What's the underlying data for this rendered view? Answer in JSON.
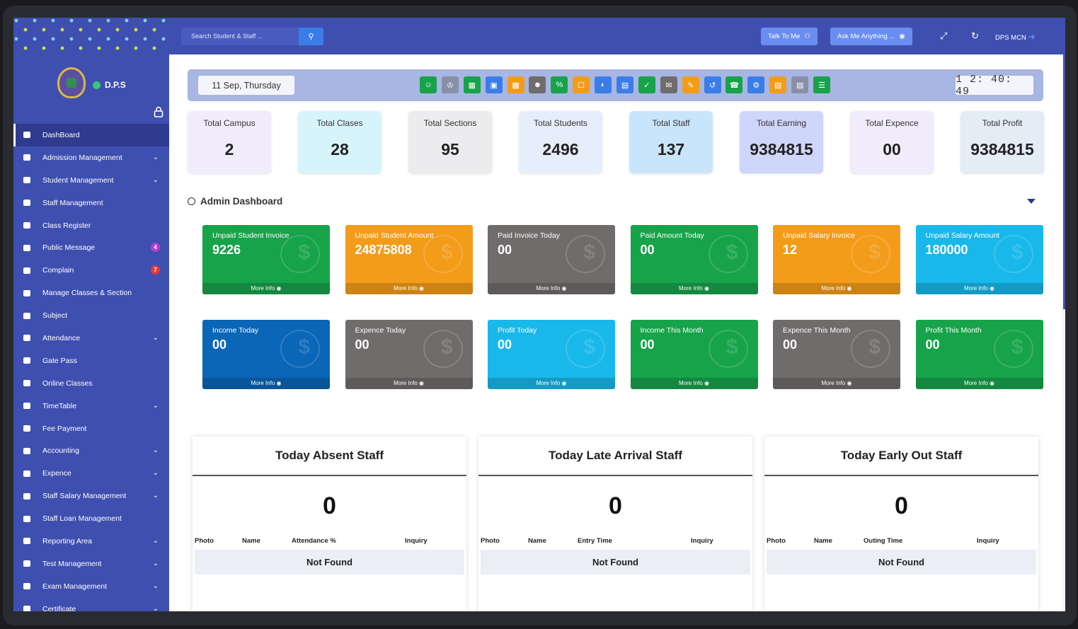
{
  "brand": {
    "name": "D.P.S"
  },
  "colors": {
    "primary": "#3f4fb0",
    "accent": "#3b7de8",
    "green": "#17a34a",
    "orange": "#f39c1a",
    "gray": "#706c6c",
    "cyan": "#18b8ea",
    "blue": "#0a66b7"
  },
  "sidebar": {
    "items": [
      {
        "label": "DashBoard",
        "icon": "dashboard-icon",
        "active": true
      },
      {
        "label": "Admission Management",
        "icon": "admission-icon",
        "has_submenu": true
      },
      {
        "label": "Student Management",
        "icon": "students-icon",
        "has_submenu": true
      },
      {
        "label": "Staff Management",
        "icon": "staff-icon"
      },
      {
        "label": "Class Register",
        "icon": "register-icon"
      },
      {
        "label": "Public Message",
        "icon": "message-icon",
        "badge": "4",
        "badge_color": "#b03fd0"
      },
      {
        "label": "Complain",
        "icon": "complain-icon",
        "badge": "7",
        "badge_color": "#e53935"
      },
      {
        "label": "Manage Classes & Section",
        "icon": "classes-icon"
      },
      {
        "label": "Subject",
        "icon": "subject-icon"
      },
      {
        "label": "Attendance",
        "icon": "attendance-icon",
        "has_submenu": true
      },
      {
        "label": "Gate Pass",
        "icon": "gate-pass-icon"
      },
      {
        "label": "Online Classes",
        "icon": "online-classes-icon"
      },
      {
        "label": "TimeTable",
        "icon": "timetable-icon",
        "has_submenu": true
      },
      {
        "label": "Fee Payment",
        "icon": "fee-payment-icon"
      },
      {
        "label": "Accounting",
        "icon": "accounting-icon",
        "has_submenu": true
      },
      {
        "label": "Expence",
        "icon": "expence-icon",
        "has_submenu": true
      },
      {
        "label": "Staff Salary Management",
        "icon": "salary-icon",
        "has_submenu": true
      },
      {
        "label": "Staff Loan Management",
        "icon": "loan-icon"
      },
      {
        "label": "Reporting Area",
        "icon": "reporting-icon",
        "has_submenu": true
      },
      {
        "label": "Test Management",
        "icon": "test-icon",
        "has_submenu": true
      },
      {
        "label": "Exam Management",
        "icon": "exam-icon",
        "has_submenu": true
      },
      {
        "label": "Certificate",
        "icon": "certificate-icon",
        "has_submenu": true
      }
    ]
  },
  "topbar": {
    "search_placeholder": "Search Student & Staff ...",
    "talk_label": "Talk To Me",
    "ask_label": "Ask Me Anything ...",
    "user_label": "DPS MCN"
  },
  "header": {
    "date": "11 Sep, Thursday",
    "clock": "1 2: 40: 49"
  },
  "quick_icons": [
    {
      "icon": "add-user-icon",
      "color": "#17a34a"
    },
    {
      "icon": "teacher-icon",
      "color": "#8a8fa8"
    },
    {
      "icon": "board-icon",
      "color": "#17a34a"
    },
    {
      "icon": "presentation-icon",
      "color": "#3b7de8"
    },
    {
      "icon": "id-card-icon",
      "color": "#f39c1a"
    },
    {
      "icon": "user-settings-icon",
      "color": "#706c6c"
    },
    {
      "icon": "percent-icon",
      "color": "#17a34a"
    },
    {
      "icon": "bag-icon",
      "color": "#f39c1a"
    },
    {
      "icon": "pie-icon",
      "color": "#3b7de8"
    },
    {
      "icon": "meeting-icon",
      "color": "#3b7de8"
    },
    {
      "icon": "user-check-icon",
      "color": "#17a34a"
    },
    {
      "icon": "chat-icon",
      "color": "#706c6c"
    },
    {
      "icon": "note-icon",
      "color": "#f39c1a"
    },
    {
      "icon": "history-icon",
      "color": "#3b7de8"
    },
    {
      "icon": "bell-icon",
      "color": "#17a34a"
    },
    {
      "icon": "gear-icon",
      "color": "#3b7de8"
    },
    {
      "icon": "book-icon",
      "color": "#f39c1a"
    },
    {
      "icon": "id-icon",
      "color": "#8a8fa8"
    },
    {
      "icon": "list-icon",
      "color": "#17a34a"
    }
  ],
  "stats": [
    {
      "label": "Total Campus",
      "value": "2",
      "bg": "#f1ecfb"
    },
    {
      "label": "Total Clases",
      "value": "28",
      "bg": "#d8f4fb"
    },
    {
      "label": "Total Sections",
      "value": "95",
      "bg": "#ececef"
    },
    {
      "label": "Total Students",
      "value": "2496",
      "bg": "#e7eefb"
    },
    {
      "label": "Total Staff",
      "value": "137",
      "bg": "#c9e5fb"
    },
    {
      "label": "Total Earning",
      "value": "9384815",
      "bg": "#cfd6fb"
    },
    {
      "label": "Total Expence",
      "value": "00",
      "bg": "#f1ecfb"
    },
    {
      "label": "Total Profit",
      "value": "9384815",
      "bg": "#e4ecf6"
    }
  ],
  "admin": {
    "title": "Admin Dashboard",
    "more_label": "More Info"
  },
  "cards_row1": [
    {
      "label": "Unpaid Student Invoice",
      "value": "9226",
      "color": "#17a34a"
    },
    {
      "label": "Unpaid Student Amount",
      "value": "24875808",
      "color": "#f39c1a"
    },
    {
      "label": "Paid Invoice Today",
      "value": "00",
      "color": "#706c6c"
    },
    {
      "label": "Paid Amount Today",
      "value": "00",
      "color": "#17a34a"
    },
    {
      "label": "Unpaid Salary Invoice",
      "value": "12",
      "color": "#f39c1a"
    },
    {
      "label": "Unpaid Salary Amount",
      "value": "180000",
      "color": "#18b8ea"
    }
  ],
  "cards_row2": [
    {
      "label": "Income Today",
      "value": "00",
      "color": "#0a66b7"
    },
    {
      "label": "Expence Today",
      "value": "00",
      "color": "#706c6c"
    },
    {
      "label": "Profit Today",
      "value": "00",
      "color": "#18b8ea"
    },
    {
      "label": "Income This Month",
      "value": "00",
      "color": "#17a34a"
    },
    {
      "label": "Expence This Month",
      "value": "00",
      "color": "#706c6c"
    },
    {
      "label": "Profit This Month",
      "value": "00",
      "color": "#17a34a"
    }
  ],
  "panels": [
    {
      "title": "Today Absent Staff",
      "count": "0",
      "columns": [
        "Photo",
        "Name",
        "Attendance %",
        "Inquiry"
      ],
      "empty": "Not Found"
    },
    {
      "title": "Today Late Arrival Staff",
      "count": "0",
      "columns": [
        "Photo",
        "Name",
        "Entry Time",
        "Inquiry"
      ],
      "empty": "Not Found"
    },
    {
      "title": "Today Early Out Staff",
      "count": "0",
      "columns": [
        "Photo",
        "Name",
        "Outing Time",
        "Inquiry"
      ],
      "empty": "Not Found"
    }
  ]
}
